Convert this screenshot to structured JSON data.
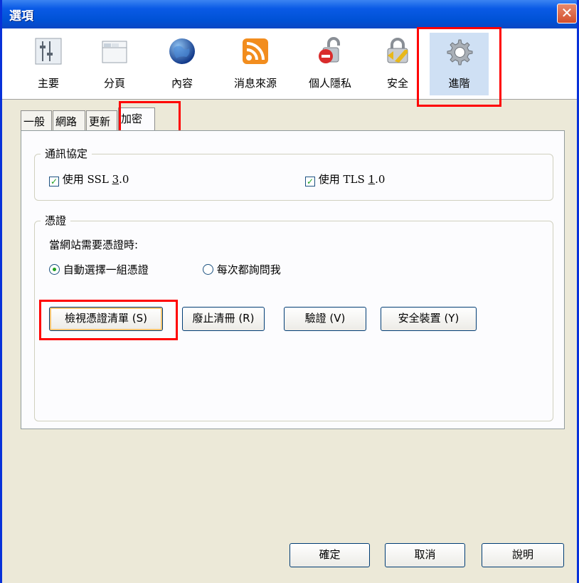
{
  "window": {
    "title": "選項",
    "close_label": "✕"
  },
  "toolbar": {
    "panes": [
      {
        "label": "主要",
        "icon": "main-icon"
      },
      {
        "label": "分頁",
        "icon": "tabs-icon"
      },
      {
        "label": "內容",
        "icon": "content-icon"
      },
      {
        "label": "消息來源",
        "icon": "feed-icon"
      },
      {
        "label": "個人隱私",
        "icon": "privacy-icon"
      },
      {
        "label": "安全",
        "icon": "security-lock-icon"
      },
      {
        "label": "進階",
        "icon": "gear-icon",
        "selected": true
      }
    ]
  },
  "tabs": [
    {
      "label": "一般"
    },
    {
      "label": "網路"
    },
    {
      "label": "更新"
    },
    {
      "label": "加密",
      "active": true
    }
  ],
  "protocols": {
    "legend": "通訊協定",
    "ssl": {
      "label": "使用 SSL ",
      "underlined": "3",
      "suffix": ".0",
      "checked": true
    },
    "tls": {
      "label": "使用 TLS ",
      "underlined": "1",
      "suffix": ".0",
      "checked": true
    }
  },
  "certificates": {
    "legend": "憑證",
    "prompt": "當網站需要憑證時:",
    "options": [
      {
        "label": "自動選擇一組憑證",
        "selected": true
      },
      {
        "label": "每次都詢問我",
        "selected": false
      }
    ],
    "buttons": [
      {
        "label": "檢視憑證清單 (S)"
      },
      {
        "label": "廢止清冊 (R)"
      },
      {
        "label": "驗證 (V)"
      },
      {
        "label": "安全裝置 (Y)"
      }
    ]
  },
  "footer": {
    "ok": "確定",
    "cancel": "取消",
    "help": "說明"
  },
  "colors": {
    "highlight": "#ff0000",
    "title_bar": "#0052d6",
    "selected_pane": "#cfe0f4"
  }
}
